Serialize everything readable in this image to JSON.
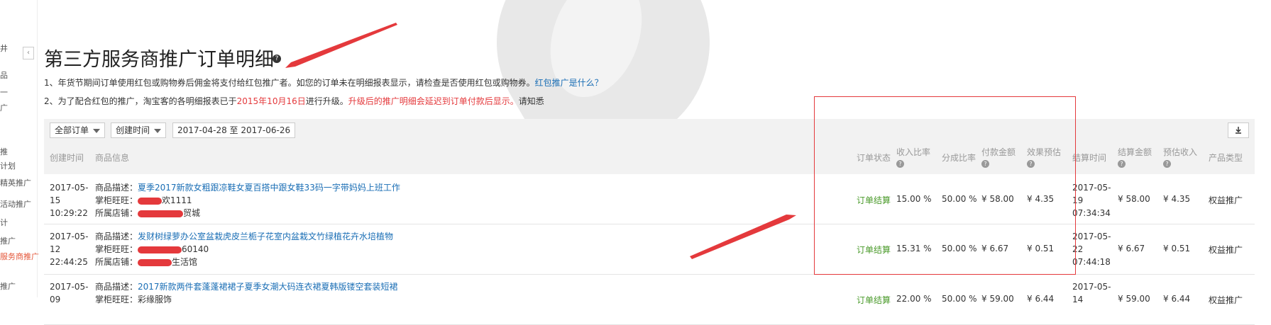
{
  "sidebar": {
    "items": [
      "井",
      "品",
      "一",
      "广",
      "",
      "推",
      "计划",
      "精英推广",
      "活动推广",
      "计",
      "推广",
      "服务商推广",
      "推广",
      "推广"
    ]
  },
  "page": {
    "title": "第三方服务商推广订单明细",
    "notice1": {
      "text": "1、年货节期间订单使用红包或购物券后佣金将支付给红包推广者。如您的订单未在明细报表显示，请检查是否使用红包或购物券。",
      "link": "红包推广是什么？"
    },
    "notice2": {
      "prefix": "2、为了配合红包的推广，淘宝客的各明细报表已于",
      "date": "2015年10月16日",
      "middle": "进行升级。",
      "highlight": "升级后的推广明细会延迟到订单付款后显示。",
      "suffix": "请知悉"
    }
  },
  "toolbar": {
    "order_filter": "全部订单",
    "time_filter": "创建时间",
    "date_range": "2017-04-28 至 2017-06-26"
  },
  "table": {
    "headers": {
      "created": "创建时间",
      "product": "商品信息",
      "status": "订单状态",
      "income_ratio": "收入比率",
      "share_ratio": "分成比率",
      "paid_amount": "付款金额",
      "effect_estimate": "效果预估",
      "settle_time": "结算时间",
      "settle_amount": "结算金额",
      "estimated_income": "预估收入",
      "product_type": "产品类型"
    },
    "labels": {
      "desc": "商品描述：",
      "seller": "掌柜旺旺：",
      "shop": "所属店铺："
    },
    "rows": [
      {
        "created_date": "2017-05-",
        "created_day": "15",
        "created_time": "10:29:22",
        "desc": "夏季2017新款女粗跟凉鞋女夏百搭中跟女鞋33码一字带妈妈上班工作",
        "seller": "欢1111",
        "shop": "贸城",
        "status": "订单结算",
        "income_ratio": "15.00 %",
        "share_ratio": "50.00 %",
        "paid_amount": "¥ 58.00",
        "effect_estimate": "¥ 4.35",
        "settle_date": "2017-05-",
        "settle_day": "19",
        "settle_time": "07:34:34",
        "settle_amount": "¥ 58.00",
        "estimated_income": "¥ 4.35",
        "product_type": "权益推广"
      },
      {
        "created_date": "2017-05-",
        "created_day": "12",
        "created_time": "22:44:25",
        "desc": "发财树绿萝办公室盆栽虎皮兰栀子花室内盆栽文竹绿植花卉水培植物",
        "seller": "60140",
        "shop": "生活馆",
        "status": "订单结算",
        "income_ratio": "15.31 %",
        "share_ratio": "50.00 %",
        "paid_amount": "¥ 6.67",
        "effect_estimate": "¥ 0.51",
        "settle_date": "2017-05-",
        "settle_day": "22",
        "settle_time": "07:44:18",
        "settle_amount": "¥ 6.67",
        "estimated_income": "¥ 0.51",
        "product_type": "权益推广"
      },
      {
        "created_date": "2017-05-",
        "created_day": "09",
        "created_time": "",
        "desc": "2017新款两件套蓬蓬裙裙子夏季女潮大码连衣裙夏韩版镂空套装短裙",
        "seller": "彩缘服饰",
        "shop": "",
        "status": "订单结算",
        "income_ratio": "22.00 %",
        "share_ratio": "50.00 %",
        "paid_amount": "¥ 59.00",
        "effect_estimate": "¥ 6.44",
        "settle_date": "2017-05-",
        "settle_day": "14",
        "settle_time": "",
        "settle_amount": "¥ 59.00",
        "estimated_income": "¥ 6.44",
        "product_type": "权益推广"
      }
    ]
  },
  "colors": {
    "accent_red": "#e4393c",
    "link_blue": "#1a6eb5",
    "status_green": "#4a9a2a"
  }
}
